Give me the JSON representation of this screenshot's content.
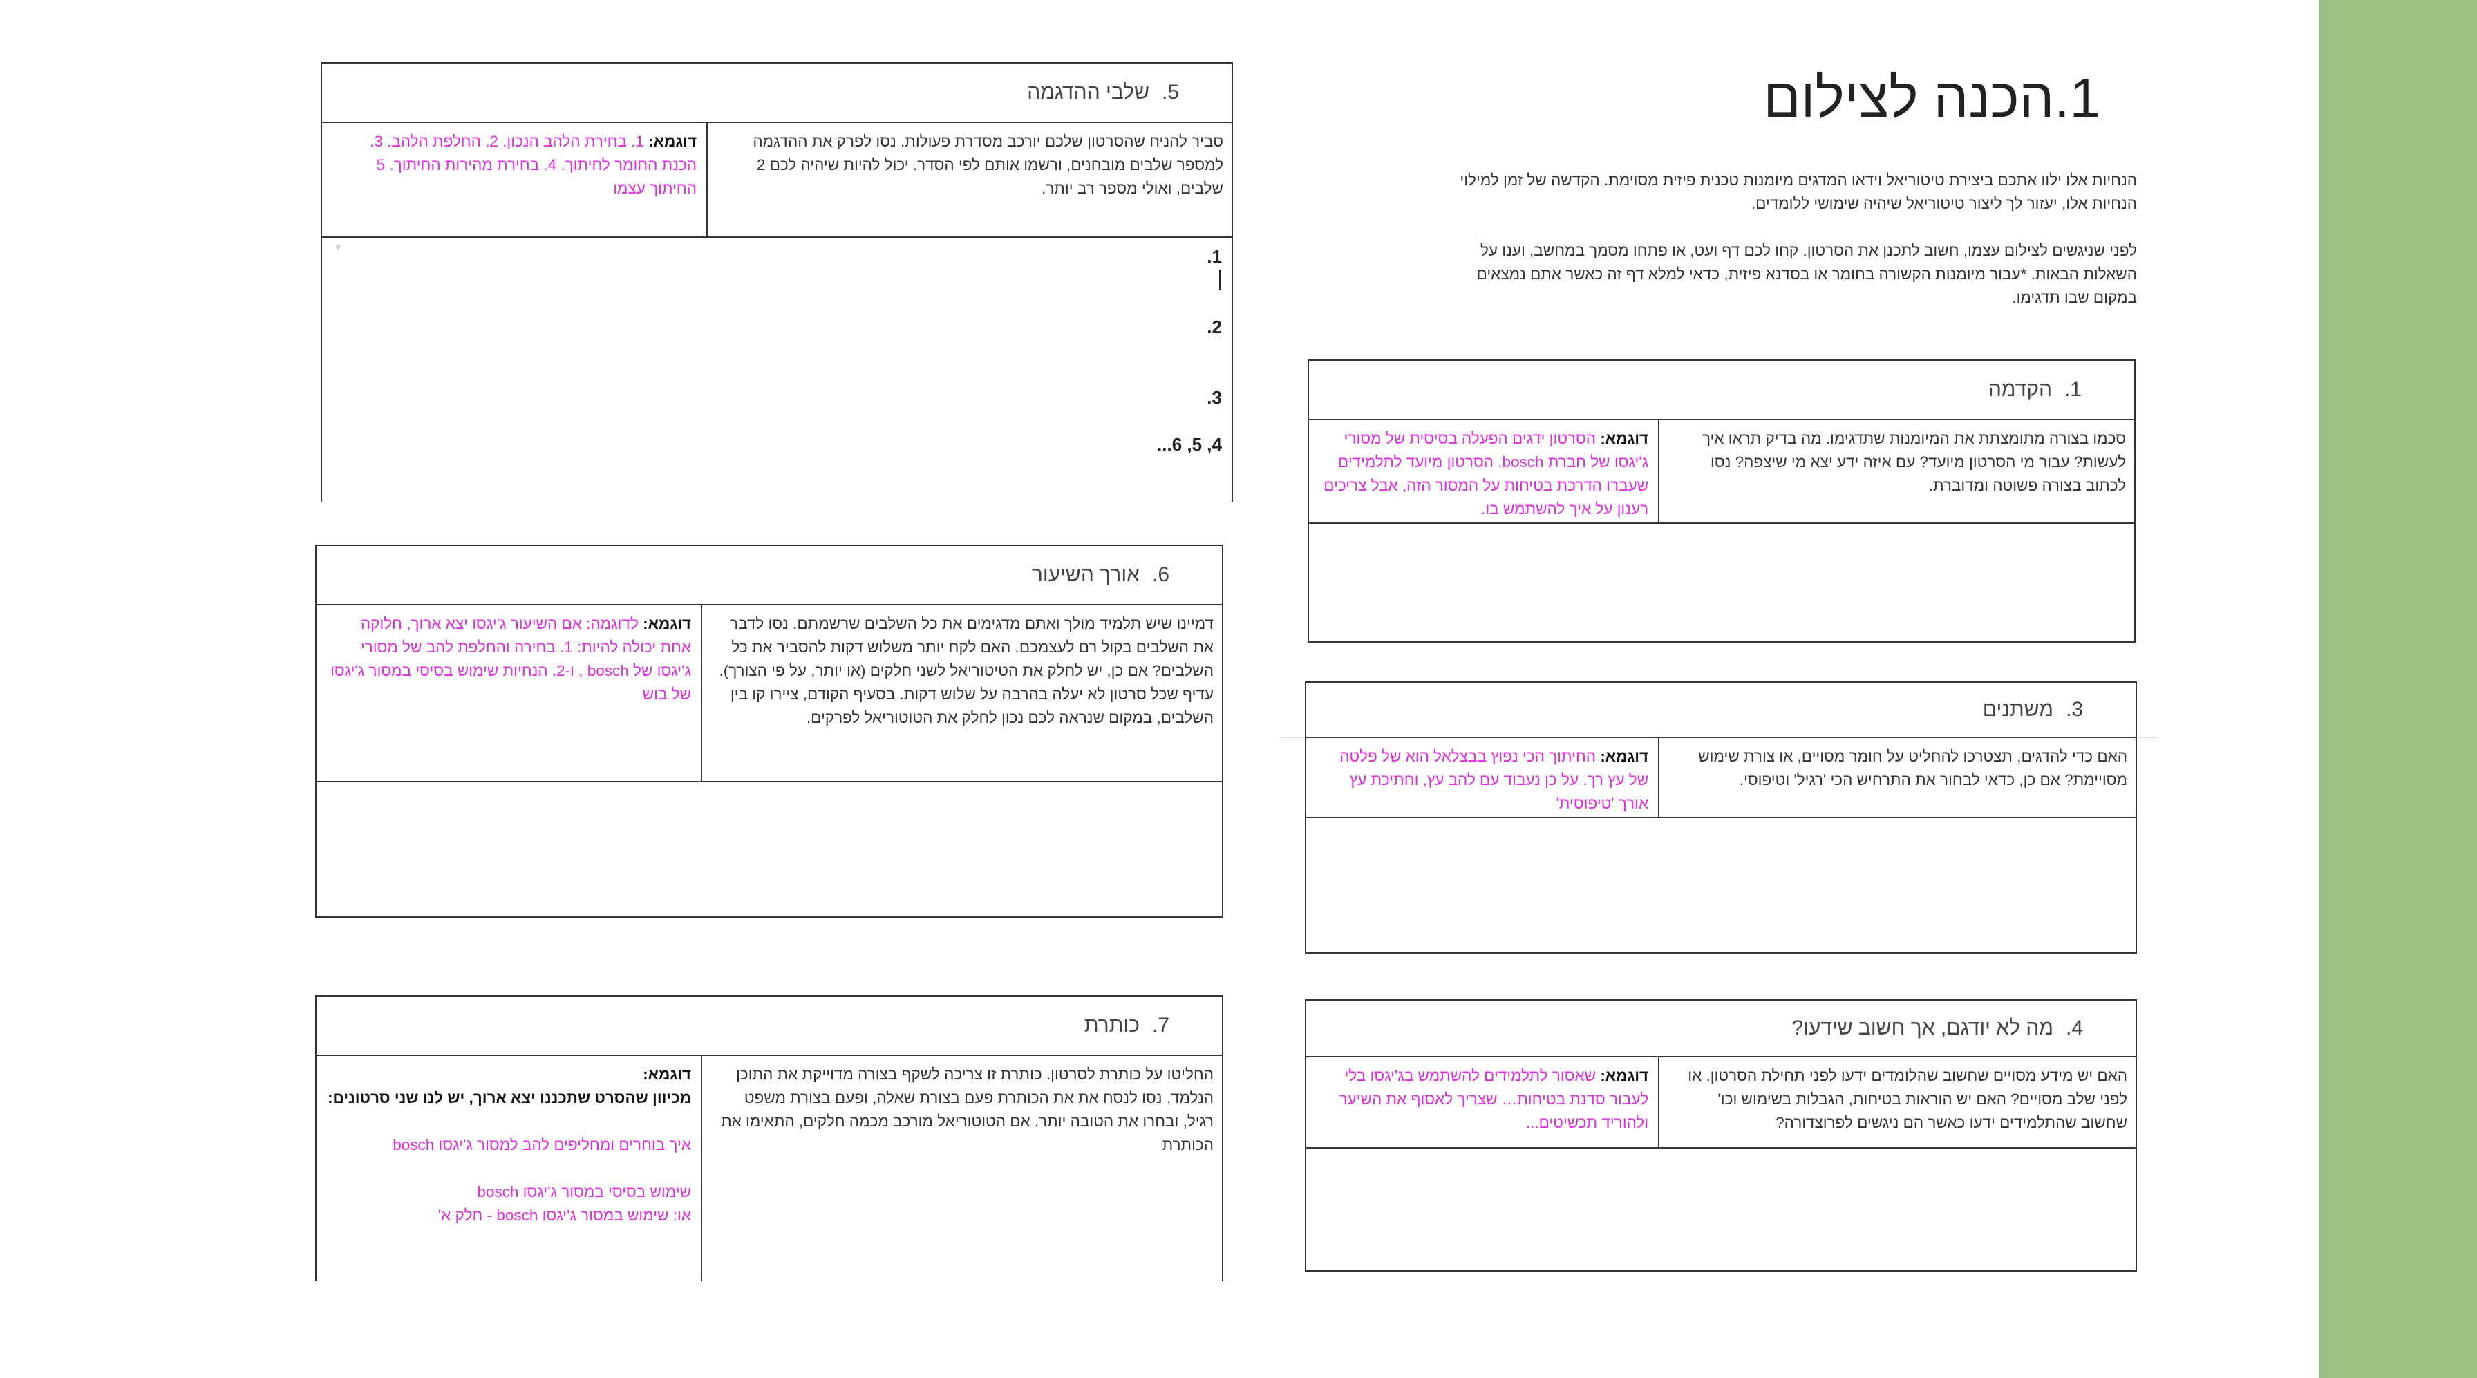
{
  "title": "1.הכנה לצילום",
  "intro": {
    "p1": "הנחיות אלו ילוו אתכם ביצירת טיטוריאל וידאו המדגים מיומנות טכנית פיזית מסוימת. הקדשה של זמן למילוי הנחיות אלו, יעזור לך ליצור טיטוריאל שיהיה שימושי ללומדים.",
    "p2": "לפני שניגשים לצילום עצמו, חשוב לתכנן את הסרטון. קחו לכם דף ועט, או פתחו מסמך במחשב, וענו על השאלות הבאות. *עבור מיומנות הקשורה בחומר או בסדנא פיזית, כדאי למלא דף זה כאשר אתם נמצאים במקום שבו תדגימו."
  },
  "sections": {
    "s1": {
      "num": "1.",
      "title": "הקדמה",
      "desc": "סכמו בצורה מתומצתת את המיומנות שתדגימו. מה בדיק תראו איך לעשות? עבור מי הסרטון מיועד? עם איזה ידע יצא מי שיצפה? נסו לכתוב בצורה פשוטה ומדוברת.",
      "ex_label": "דוגמא:",
      "ex_text": "הסרטון ידגים הפעלה בסיסית של מסורי ג'יגסו של חברת bosch. הסרטון מיועד לתלמידים שעברו הדרכת בטיחות על המסור הזה, אבל צריכים רענון על איך להשתמש בו."
    },
    "s3": {
      "num": "3.",
      "title": "משתנים",
      "desc": "האם כדי להדגים, תצטרכו להחליט על חומר מסויים, או צורת שימוש מסויימת? אם כן, כדאי לבחור את התרחיש הכי 'רגיל' וטיפוסי.",
      "ex_label": "דוגמא:",
      "ex_text": "החיתוך הכי נפוץ בבצלאל הוא של פלטה של עץ רך. על כן נעבוד עם להב עץ, וחתיכת עץ אורך 'טיפוסית'"
    },
    "s4": {
      "num": "4.",
      "title": "מה לא יודגם, אך חשוב שידעו?",
      "desc": "האם יש מידע מסויים שחשוב שהלומדים ידעו לפני תחילת הסרטון. או לפני שלב מסויים? האם יש הוראות בטיחות, הגבלות בשימוש וכו' שחשוב שהתלמידים ידעו כאשר הם ניגשים לפרוצדורה?",
      "ex_label": "דוגמא:",
      "ex_text": "שאסור לתלמידים להשתמש בג'יגסו בלי לעבור סדנת בטיחות… שצריך לאסוף את השיער ולהוריד תכשיטים..."
    },
    "s5": {
      "num": "5.",
      "title": "שלבי ההדגמה",
      "desc": "סביר להניח שהסרטון שלכם יורכב מסדרת פעולות. נסו לפרק את ההדגמה למספר שלבים מובחנים, ורשמו אותם לפי הסדר. יכול להיות שיהיה לכם 2 שלבים, ואולי מספר רב יותר.",
      "ex_label": "דוגמא:",
      "ex_text": "1. בחירת הלהב הנכון. 2. החלפת הלהב. 3. הכנת החומר לחיתוך. 4. בחירת מהירות החיתוך. 5 החיתוך עצמו",
      "steps": [
        "1.",
        "2.",
        "3.",
        "4, 5, 6..."
      ]
    },
    "s6": {
      "num": "6.",
      "title": "אורך השיעור",
      "desc": "דמיינו שיש תלמיד מולך ואתם מדגימים את כל השלבים שרשמתם. נסו לדבר את השלבים בקול רם לעצמכם. האם לקח יותר משלוש דקות להסביר את כל השלבים? אם כן, יש לחלק את הטיטוריאל לשני חלקים (או יותר, על פי הצורך). עדיף שכל סרטון לא יעלה בהרבה על שלוש דקות. בסעיף הקודם, ציירו קו בין השלבים, במקום שנראה לכם נכון לחלק את הטוטוריאל לפרקים.",
      "ex_label": "דוגמא:",
      "ex_text": "לדוגמה: אם השיעור ג'יגסו יצא ארוך, חלוקה אחת יכולה להיות: 1. בחירה והחלפת להב של מסורי ג'יגסו של bosch , ו-2. הנחיות שימוש בסיסי במסור ג'יגסו של בוש"
    },
    "s7": {
      "num": "7.",
      "title": "כותרת",
      "desc": "החליטו על כותרת לסרטון. כותרת זו צריכה לשקף בצורה מדוייקת את התוכן הנלמד. נסו לנסח את את הכותרת פעם בצורת שאלה, ופעם בצורת משפט רגיל, ובחרו את הטובה יותר. אם הטוטוריאל מורכב מכמה חלקים, התאימו את הכותרת",
      "ex_label": "דוגמא:",
      "ex_bold": "מכיוון שהסרט שתכננו יצא ארוך, יש לנו שני סרטונים:",
      "ex_line1": "איך בוחרים ומחליפים להב למסור ג'יגסו bosch",
      "ex_line2": "שימוש בסיסי במסור ג'יגסו bosch",
      "ex_line3": "או: שימוש במסור ג'יגסו bosch - חלק א'"
    }
  },
  "colors": {
    "accent_green": "#9bc283",
    "example_magenta": "#e12de1"
  }
}
